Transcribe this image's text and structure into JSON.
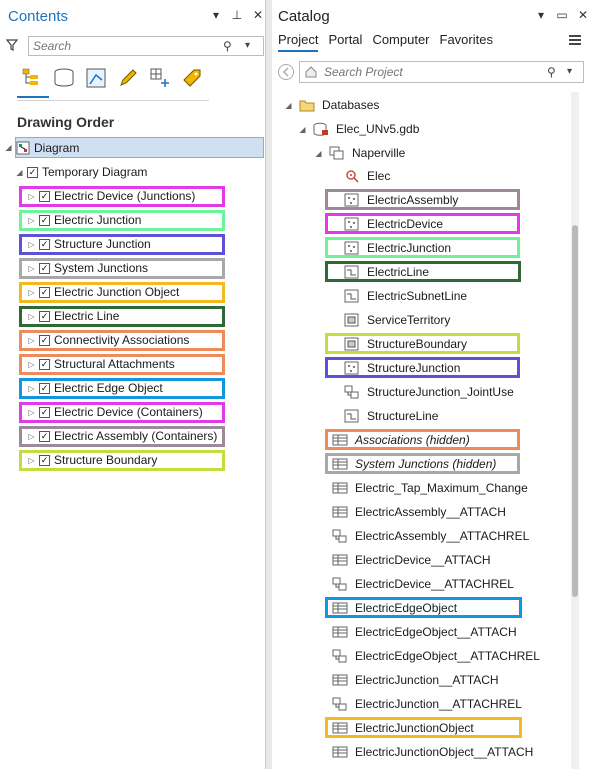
{
  "contents": {
    "title": "Contents",
    "search_placeholder": "Search",
    "drawing_order_label": "Drawing Order",
    "diagram_label": "Diagram",
    "temporary_diagram_label": "Temporary Diagram",
    "layers": [
      {
        "label": "Electric Device (Junctions)",
        "color": "#e13ae8"
      },
      {
        "label": "Electric Junction",
        "color": "#6ef29a"
      },
      {
        "label": "Structure Junction",
        "color": "#5b52d8"
      },
      {
        "label": "System Junctions",
        "color": "#a8a8a8"
      },
      {
        "label": "Electric Junction Object",
        "color": "#f5b820"
      },
      {
        "label": "Electric Line",
        "color": "#2f6a34"
      },
      {
        "label": "Connectivity Associations",
        "color": "#ef8a5a"
      },
      {
        "label": "Structural Attachments",
        "color": "#ef8a5a"
      },
      {
        "label": "Electric Edge Object",
        "color": "#1296e0"
      },
      {
        "label": "Electric Device (Containers)",
        "color": "#e13ae8"
      },
      {
        "label": "Electric Assembly (Containers)",
        "color": "#9c8a9c"
      },
      {
        "label": "Structure Boundary",
        "color": "#c4dc3e"
      }
    ]
  },
  "catalog": {
    "title": "Catalog",
    "tabs": [
      "Project",
      "Portal",
      "Computer",
      "Favorites"
    ],
    "search_placeholder": "Search Project",
    "tree": {
      "databases": "Databases",
      "gdb": "Elec_UNv5.gdb",
      "dataset": "Naperville"
    },
    "items": [
      {
        "label": "Elec",
        "icon": "network",
        "italic": false,
        "color": ""
      },
      {
        "label": "ElectricAssembly",
        "icon": "point",
        "italic": false,
        "color": "#9c8a9c"
      },
      {
        "label": "ElectricDevice",
        "icon": "point",
        "italic": false,
        "color": "#e13ae8"
      },
      {
        "label": "ElectricJunction",
        "icon": "point",
        "italic": false,
        "color": "#6ef29a"
      },
      {
        "label": "ElectricLine",
        "icon": "line",
        "italic": false,
        "color": "#2f6a34"
      },
      {
        "label": "ElectricSubnetLine",
        "icon": "line",
        "italic": false,
        "color": ""
      },
      {
        "label": "ServiceTerritory",
        "icon": "polygon",
        "italic": false,
        "color": ""
      },
      {
        "label": "StructureBoundary",
        "icon": "polygon",
        "italic": false,
        "color": "#c4dc3e"
      },
      {
        "label": "StructureJunction",
        "icon": "point",
        "italic": false,
        "color": "#5b52d8"
      },
      {
        "label": "StructureJunction_JointUse",
        "icon": "relationship",
        "italic": false,
        "color": ""
      },
      {
        "label": "StructureLine",
        "icon": "line",
        "italic": false,
        "color": ""
      },
      {
        "label": "Associations (hidden)",
        "icon": "table",
        "italic": true,
        "color": "#ef8a5a"
      },
      {
        "label": "System Junctions (hidden)",
        "icon": "table",
        "italic": true,
        "color": "#a8a8a8"
      },
      {
        "label": "Electric_Tap_Maximum_Change",
        "icon": "table",
        "italic": false,
        "color": ""
      },
      {
        "label": "ElectricAssembly__ATTACH",
        "icon": "table",
        "italic": false,
        "color": ""
      },
      {
        "label": "ElectricAssembly__ATTACHREL",
        "icon": "relationship",
        "italic": false,
        "color": ""
      },
      {
        "label": "ElectricDevice__ATTACH",
        "icon": "table",
        "italic": false,
        "color": ""
      },
      {
        "label": "ElectricDevice__ATTACHREL",
        "icon": "relationship",
        "italic": false,
        "color": ""
      },
      {
        "label": "ElectricEdgeObject",
        "icon": "table",
        "italic": false,
        "color": "#1296e0"
      },
      {
        "label": "ElectricEdgeObject__ATTACH",
        "icon": "table",
        "italic": false,
        "color": ""
      },
      {
        "label": "ElectricEdgeObject__ATTACHREL",
        "icon": "relationship",
        "italic": false,
        "color": ""
      },
      {
        "label": "ElectricJunction__ATTACH",
        "icon": "table",
        "italic": false,
        "color": ""
      },
      {
        "label": "ElectricJunction__ATTACHREL",
        "icon": "relationship",
        "italic": false,
        "color": ""
      },
      {
        "label": "ElectricJunctionObject",
        "icon": "table",
        "italic": false,
        "color": "#f5b820"
      },
      {
        "label": "ElectricJunctionObject__ATTACH",
        "icon": "table",
        "italic": false,
        "color": ""
      }
    ]
  }
}
